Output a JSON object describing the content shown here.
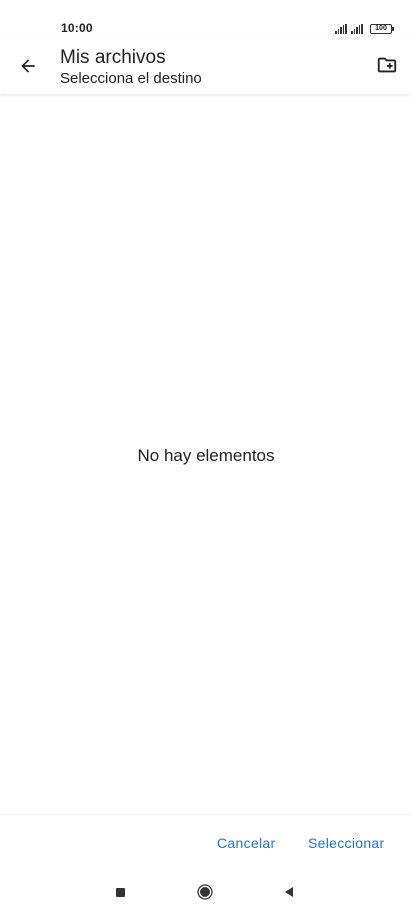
{
  "status_bar": {
    "time": "10:00",
    "battery": "100"
  },
  "header": {
    "title": "Mis archivos",
    "subtitle": "Selecciona el destino",
    "back_icon": "arrow-back-icon",
    "new_folder_icon": "create-new-folder-icon"
  },
  "main": {
    "empty_message": "No hay elementos"
  },
  "actions": {
    "cancel_label": "Cancelar",
    "select_label": "Seleccionar",
    "accent_color": "#1a73e8"
  },
  "navigation": {
    "recents_icon": "square-recents-icon",
    "home_icon": "circle-home-icon",
    "back_icon": "triangle-back-icon"
  }
}
